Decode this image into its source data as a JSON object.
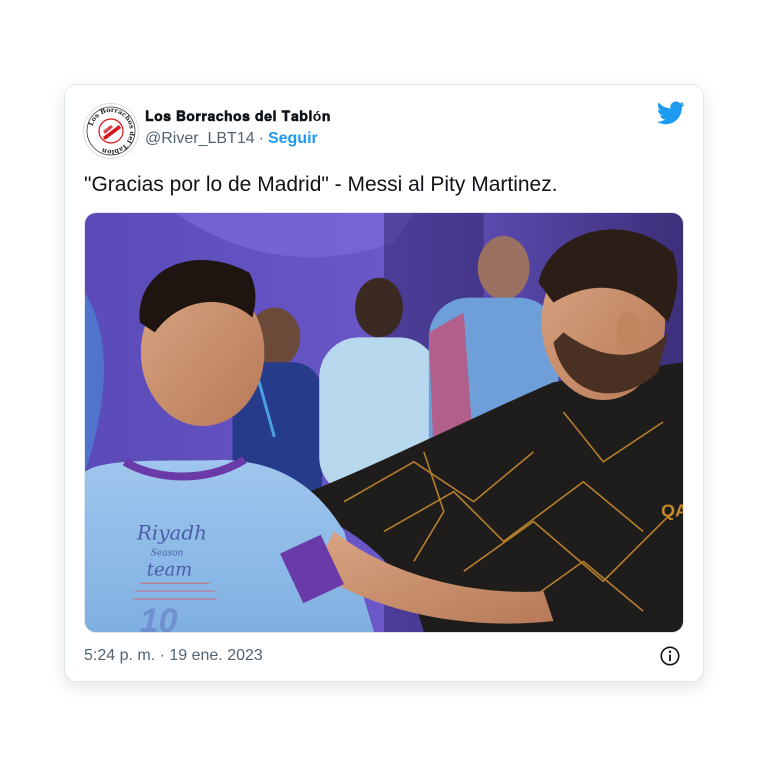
{
  "tweet": {
    "account": {
      "display_name": "𝐋𝐨𝐬 𝐁𝐨𝐫𝐫𝐚𝐜𝐡𝐨𝐬 𝐝𝐞𝐥 𝐓𝐚𝐛𝐥ó𝐧",
      "avatar_ring_text": "Los Borrachos del Tablón",
      "handle": "@River_LBT14",
      "separator": "·",
      "follow_label": "Seguir"
    },
    "text": "\"Gracias por lo de Madrid\" - Messi al Pity Martinez.",
    "media": {
      "jersey_lines": [
        "Riyadh",
        "Season",
        "team"
      ],
      "jersey_number": "10",
      "sponsor_text": "QA"
    },
    "timestamp": "5:24 p. m. · 19 ene. 2023"
  },
  "icons": {
    "brand": "twitter-bird-icon",
    "info": "info-icon"
  },
  "colors": {
    "accent": "#1d9bf0",
    "muted": "#536471",
    "text": "#0f1419",
    "avatar_red": "#d7141a"
  }
}
